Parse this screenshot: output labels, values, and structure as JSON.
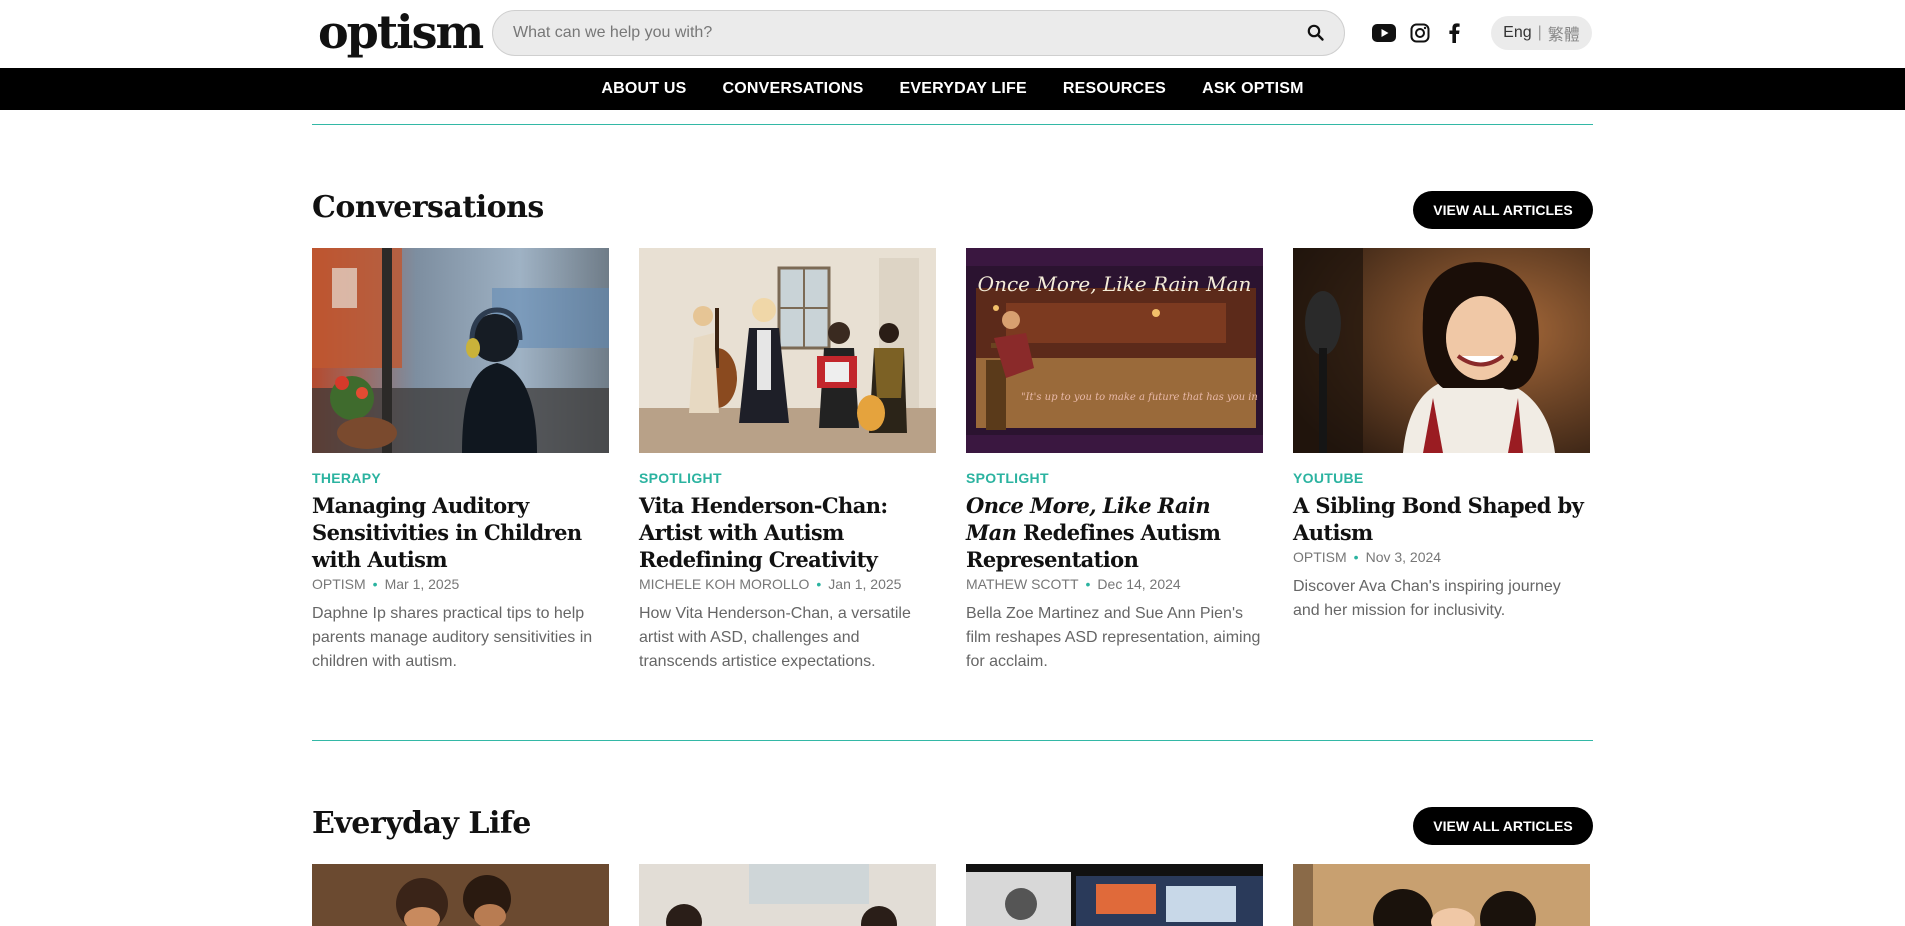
{
  "header": {
    "logo": "optism",
    "search_placeholder": "What can we help you with?",
    "social": [
      "youtube-icon",
      "instagram-icon",
      "facebook-icon"
    ],
    "lang_en": "Eng",
    "lang_sep": "|",
    "lang_zh": "繁體"
  },
  "nav": {
    "items": [
      "ABOUT US",
      "CONVERSATIONS",
      "EVERYDAY LIFE",
      "RESOURCES",
      "ASK OPTISM"
    ]
  },
  "sections": [
    {
      "title": "Conversations",
      "view_all": "VIEW ALL ARTICLES",
      "cards": [
        {
          "category": "THERAPY",
          "title": "Managing Auditory Sensitivities in Children with Autism",
          "author": "OPTISM",
          "date": "Mar 1, 2025",
          "desc": "Daphne Ip shares practical tips to help parents manage auditory sensitivities in children with autism."
        },
        {
          "category": "SPOTLIGHT",
          "title": "Vita Henderson-Chan: Artist with Autism Redefining Creativity",
          "author": "MICHELE KOH MOROLLO",
          "date": "Jan 1, 2025",
          "desc": "How Vita Henderson-Chan, a versatile artist with ASD, challenges and transcends artistice expectations."
        },
        {
          "category": "SPOTLIGHT",
          "title_italic": "Once More, Like Rain Man",
          "title": "Redefines Autism Representation",
          "author": "MATHEW SCOTT",
          "date": "Dec 14, 2024",
          "desc": "Bella Zoe Martinez and Sue Ann Pien's film reshapes ASD representation, aiming for acclaim.",
          "image_title": "Once More, Like Rain Man",
          "image_caption": "\"It's up to you to make a future that has you in it\""
        },
        {
          "category": "YOUTUBE",
          "title": "A Sibling Bond Shaped by Autism",
          "author": "OPTISM",
          "date": "Nov 3, 2024",
          "desc": "Discover Ava Chan's inspiring journey and her mission for inclusivity."
        }
      ]
    },
    {
      "title": "Everyday Life",
      "view_all": "VIEW ALL ARTICLES"
    }
  ],
  "colors": {
    "accent": "#2bb3a0",
    "nav_bg": "#000000",
    "button_bg": "#000000"
  }
}
